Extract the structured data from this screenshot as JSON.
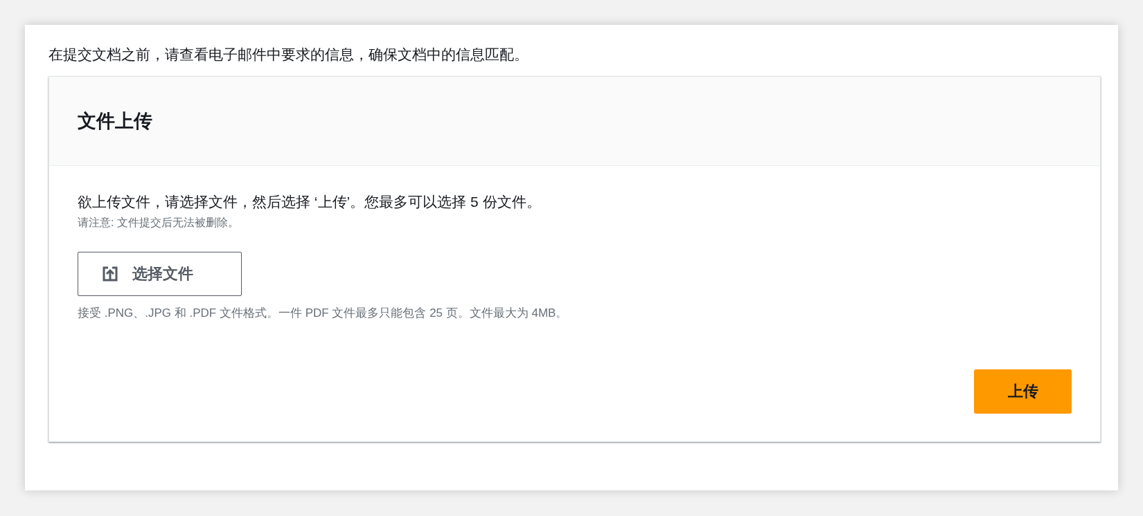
{
  "intro": "在提交文档之前，请查看电子邮件中要求的信息，确保文档中的信息匹配。",
  "panel": {
    "title": "文件上传",
    "instructions": "欲上传文件，请选择文件，然后选择 ‘上传’。您最多可以选择 5 份文件。",
    "note": "请注意: 文件提交后无法被删除。",
    "choose_button": "选择文件",
    "formats_hint": "接受 .PNG、.JPG 和 .PDF 文件格式。一件 PDF 文件最多只能包含 25 页。文件最大为 4MB。",
    "upload_button": "上传"
  }
}
